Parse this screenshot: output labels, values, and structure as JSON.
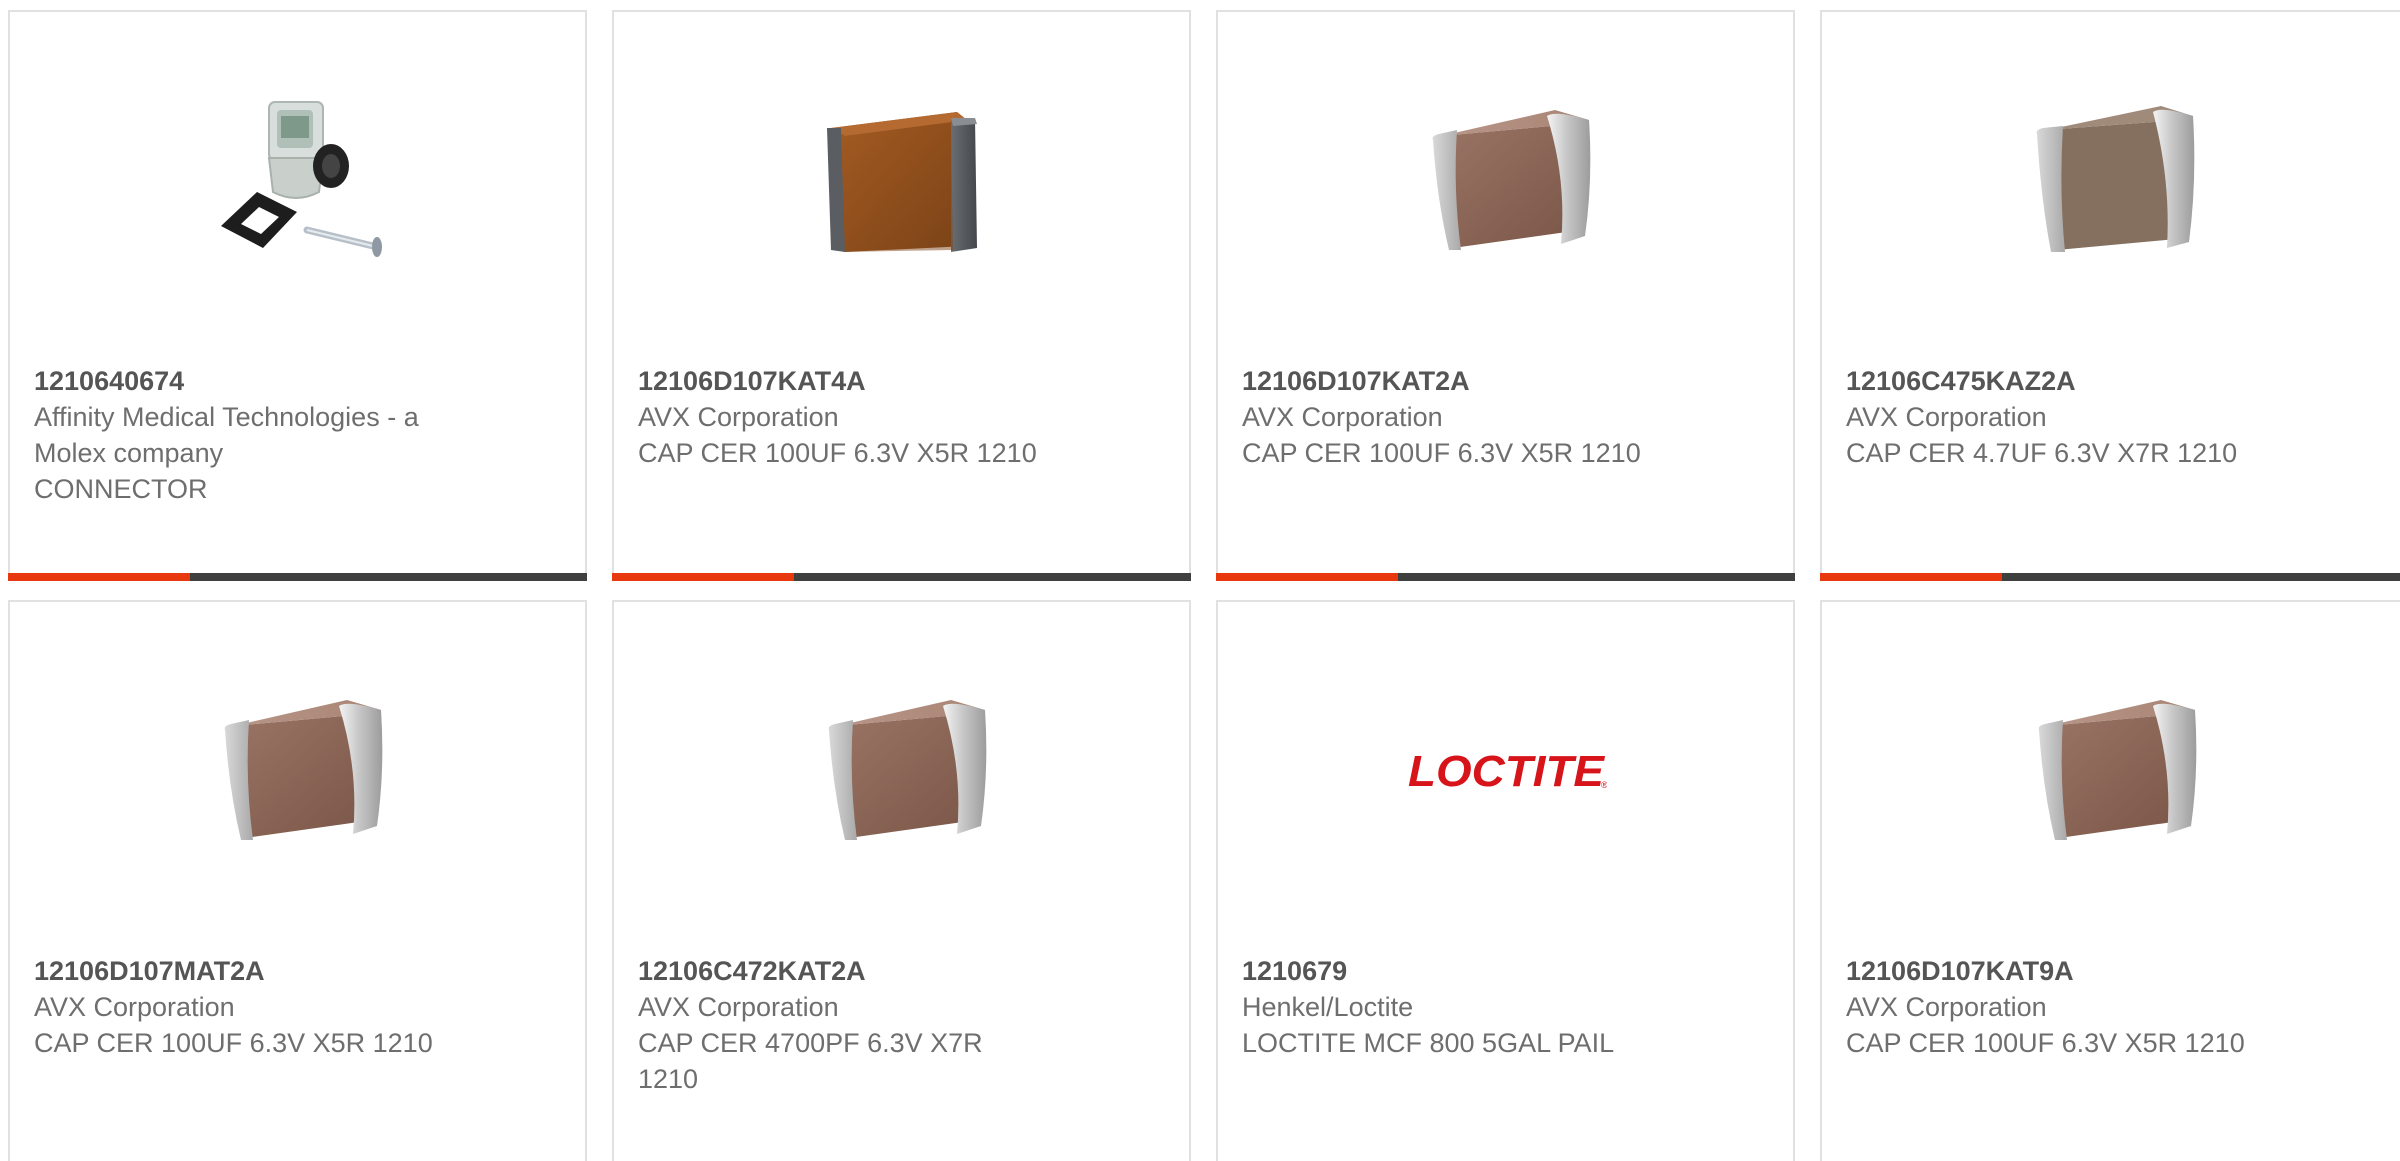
{
  "colors": {
    "accent": "#e8380d",
    "bar": "#3f3f3f",
    "text": "#6e6e6e",
    "border": "#e1e1e1",
    "loctite_red": "#d7141a"
  },
  "products": [
    {
      "part_number": "1210640674",
      "manufacturer_line1": "Affinity Medical Technologies - a",
      "manufacturer_line2": "Molex company",
      "description_line1": "CONNECTOR",
      "description_line2": "",
      "image": "solenoid-connector-icon"
    },
    {
      "part_number": "12106D107KAT4A",
      "manufacturer_line1": "AVX Corporation",
      "manufacturer_line2": "",
      "description_line1": "CAP CER 100UF 6.3V X5R 1210",
      "description_line2": "",
      "image": "capacitor-dark-icon"
    },
    {
      "part_number": "12106D107KAT2A",
      "manufacturer_line1": "AVX Corporation",
      "manufacturer_line2": "",
      "description_line1": "CAP CER 100UF 6.3V X5R 1210",
      "description_line2": "",
      "image": "capacitor-icon"
    },
    {
      "part_number": "12106C475KAZ2A",
      "manufacturer_line1": "AVX Corporation",
      "manufacturer_line2": "",
      "description_line1": "CAP CER 4.7UF 6.3V X7R 1210",
      "description_line2": "",
      "image": "capacitor-icon"
    },
    {
      "part_number": "12106D107MAT2A",
      "manufacturer_line1": "AVX Corporation",
      "manufacturer_line2": "",
      "description_line1": "CAP CER 100UF 6.3V X5R 1210",
      "description_line2": "",
      "image": "capacitor-icon"
    },
    {
      "part_number": "12106C472KAT2A",
      "manufacturer_line1": "AVX Corporation",
      "manufacturer_line2": "",
      "description_line1": "CAP CER 4700PF 6.3V X7R",
      "description_line2": "1210",
      "image": "capacitor-icon"
    },
    {
      "part_number": "1210679",
      "manufacturer_line1": "Henkel/Loctite",
      "manufacturer_line2": "",
      "description_line1": "LOCTITE MCF 800 5GAL PAIL",
      "description_line2": "",
      "image": "loctite-logo",
      "logo_text": "LOCTITE"
    },
    {
      "part_number": "12106D107KAT9A",
      "manufacturer_line1": "AVX Corporation",
      "manufacturer_line2": "",
      "description_line1": "CAP CER 100UF 6.3V X5R 1210",
      "description_line2": "",
      "image": "capacitor-icon"
    }
  ]
}
